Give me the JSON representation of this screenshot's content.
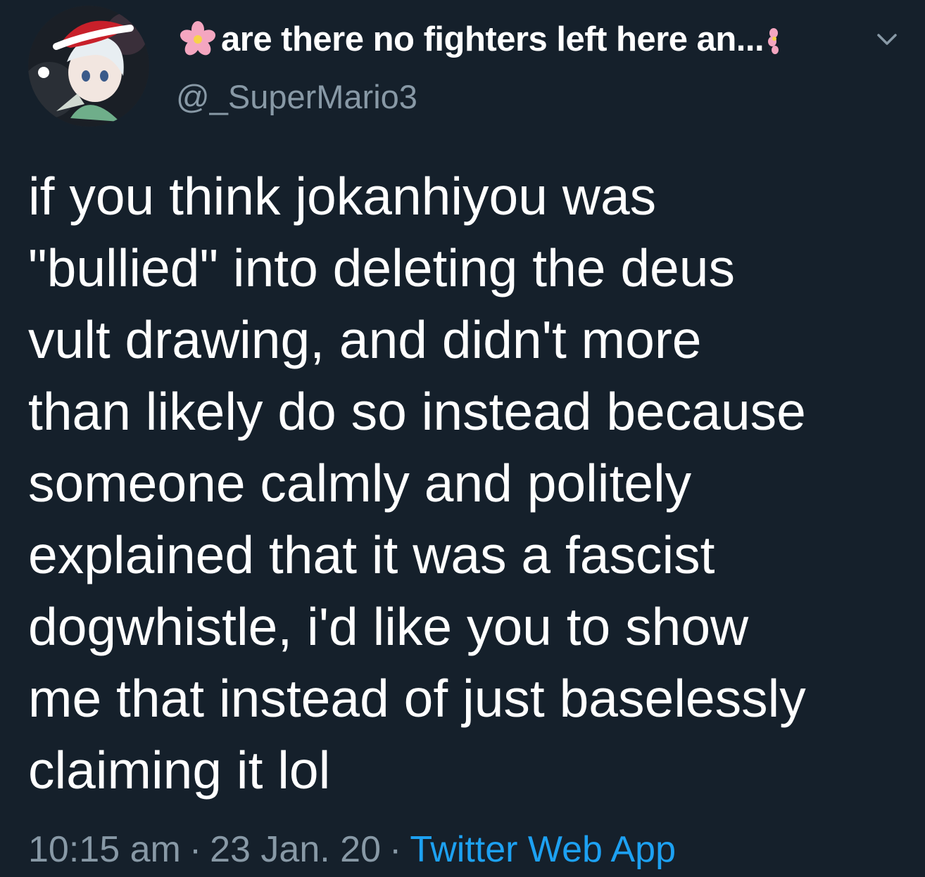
{
  "tweet": {
    "display_name": "are there no fighters left here an...",
    "handle": "@_SuperMario3",
    "body_lines": [
      "if you think jokanhiyou was",
      "\"bullied\" into deleting the deus",
      "vult drawing, and didn't more",
      "than likely do so instead because",
      "someone calmly and politely",
      "explained that it was a fascist",
      "dogwhistle, i'd like you to show",
      "me that instead of just baselessly",
      "claiming it lol"
    ],
    "time": "10:15 am",
    "separator": "·",
    "date": "23 Jan. 20",
    "source": "Twitter Web App"
  },
  "icons": {
    "avatar": "avatar-image",
    "name_prefix": "cherry-blossom-icon",
    "name_suffix": "cherry-blossom-icon",
    "menu": "chevron-down-icon"
  },
  "colors": {
    "background": "#15202b",
    "text": "#ffffff",
    "secondary": "#8899a6",
    "link": "#1da1f2"
  }
}
